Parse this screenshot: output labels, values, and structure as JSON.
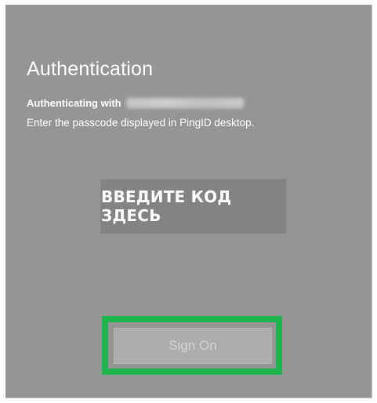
{
  "auth": {
    "title": "Authentication",
    "authenticating_label": "Authenticating with",
    "instructions": "Enter the passcode displayed in PingID desktop."
  },
  "passcode": {
    "overlay_text": "ВВЕДИТЕ КОД ЗДЕСЬ"
  },
  "sign_on": {
    "label": "Sign On"
  },
  "colors": {
    "panel_background": "#959595",
    "highlight_border": "#1db44e",
    "button_background": "#adadad"
  }
}
